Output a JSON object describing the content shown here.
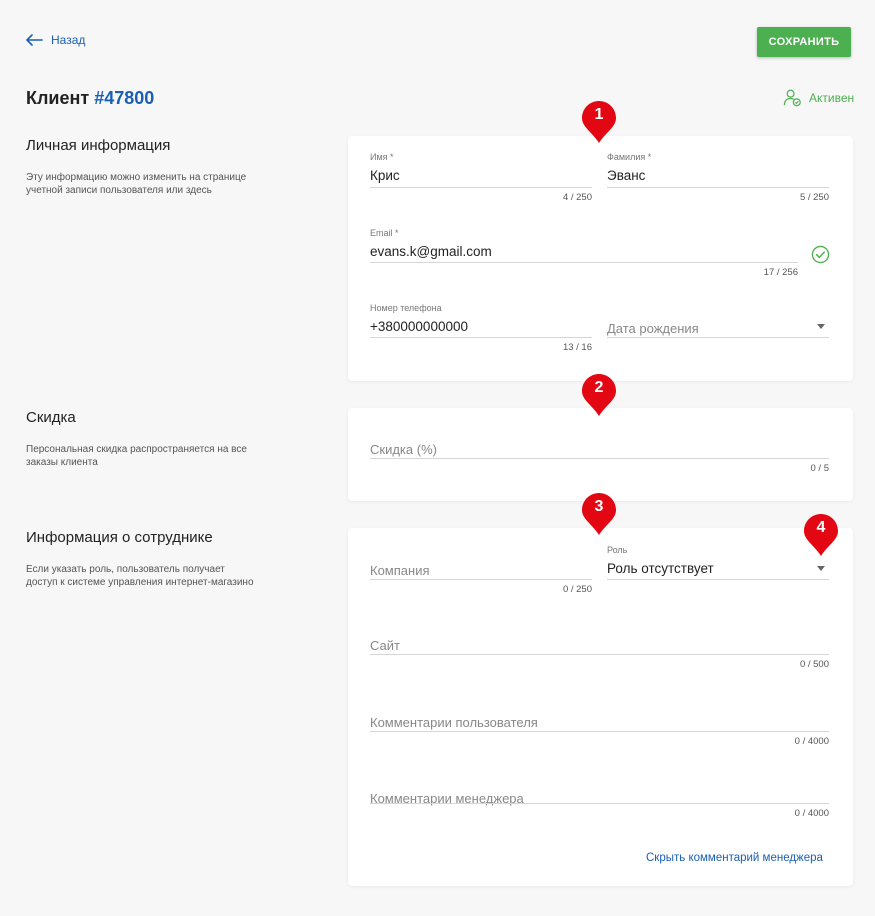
{
  "header": {
    "back_label": "Назад",
    "save_label": "СОХРАНИТЬ",
    "title_prefix": "Клиент",
    "client_number": "#47800",
    "status_label": "Активен"
  },
  "colors": {
    "accent": "#1a5fb4",
    "success": "#4caf50",
    "marker": "#e30613"
  },
  "sections": {
    "personal": {
      "title": "Личная информация",
      "description": "Эту информацию можно изменить на странице учетной записи пользователя или здесь",
      "first_name": {
        "label": "Имя *",
        "value": "Крис",
        "counter": "4 / 250"
      },
      "last_name": {
        "label": "Фамилия *",
        "value": "Эванс",
        "counter": "5 / 250"
      },
      "email": {
        "label": "Email *",
        "value": "evans.k@gmail.com",
        "counter": "17 / 256",
        "status_icon": "check-circle-icon"
      },
      "phone": {
        "label": "Номер телефона",
        "value": "+380000000000",
        "counter": "13 / 16"
      },
      "birthdate": {
        "placeholder": "Дата рождения"
      }
    },
    "discount": {
      "title": "Скидка",
      "description": "Персональная скидка распространяется на все заказы клиента",
      "discount_field": {
        "placeholder": "Скидка (%)",
        "counter": "0 / 5"
      }
    },
    "employee": {
      "title": "Информация о сотруднике",
      "description": "Если указать роль, пользователь получает доступ к системе управления интернет-магазино",
      "company": {
        "placeholder": "Компания",
        "counter": "0 / 250"
      },
      "role": {
        "label": "Роль",
        "value": "Роль отсутствует"
      },
      "site": {
        "placeholder": "Сайт",
        "counter": "0 / 500"
      },
      "user_comments": {
        "placeholder": "Комментарии пользователя",
        "counter": "0 / 4000"
      },
      "manager_comments": {
        "placeholder": "Комментарии менеджера",
        "counter": "0 / 4000"
      },
      "hide_manager_link": "Скрыть комментарий менеджера"
    }
  },
  "markers": [
    "1",
    "2",
    "3",
    "4"
  ]
}
